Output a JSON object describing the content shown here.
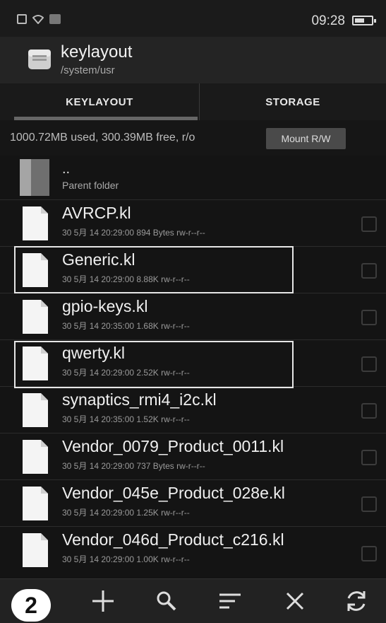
{
  "status_bar": {
    "time": "09:28",
    "battery_level": 0.6
  },
  "header": {
    "title": "keylayout",
    "path": "/system/usr"
  },
  "tabs": [
    {
      "label": "KEYLAYOUT",
      "active": true
    },
    {
      "label": "STORAGE",
      "active": false
    }
  ],
  "info": {
    "usage_text": "1000.72MB used, 300.39MB free, r/o",
    "mount_label": "Mount R/W"
  },
  "parent": {
    "name": "..",
    "label": "Parent folder"
  },
  "files": [
    {
      "name": "AVRCP.kl",
      "meta": "30 5月 14 20:29:00  894 Bytes  rw-r--r--",
      "highlighted": false
    },
    {
      "name": "Generic.kl",
      "meta": "30 5月 14 20:29:00  8.88K  rw-r--r--",
      "highlighted": true
    },
    {
      "name": "gpio-keys.kl",
      "meta": "30 5月 14 20:35:00  1.68K  rw-r--r--",
      "highlighted": false
    },
    {
      "name": "qwerty.kl",
      "meta": "30 5月 14 20:29:00  2.52K  rw-r--r--",
      "highlighted": true
    },
    {
      "name": "synaptics_rmi4_i2c.kl",
      "meta": "30 5月 14 20:35:00  1.52K  rw-r--r--",
      "highlighted": false
    },
    {
      "name": "Vendor_0079_Product_0011.kl",
      "meta": "30 5月 14 20:29:00  737 Bytes  rw-r--r--",
      "highlighted": false
    },
    {
      "name": "Vendor_045e_Product_028e.kl",
      "meta": "30 5月 14 20:29:00  1.25K  rw-r--r--",
      "highlighted": false
    },
    {
      "name": "Vendor_046d_Product_c216.kl",
      "meta": "30 5月 14 20:29:00  1.00K  rw-r--r--",
      "highlighted": false
    }
  ],
  "toolbar": {
    "badge": "2",
    "icons": [
      "add-icon",
      "search-icon",
      "sort-icon",
      "close-icon",
      "refresh-icon"
    ]
  }
}
